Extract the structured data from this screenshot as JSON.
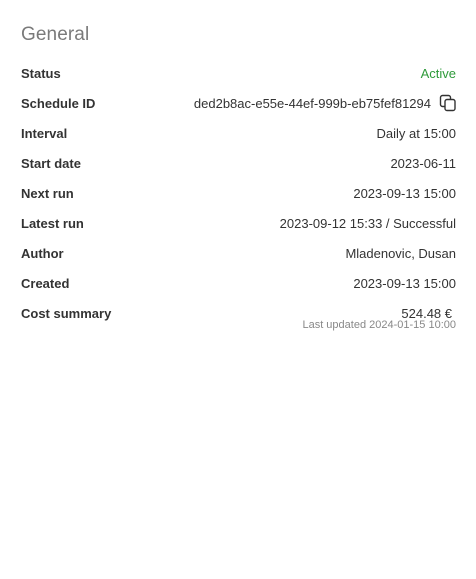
{
  "section": {
    "title": "General"
  },
  "rows": {
    "status": {
      "label": "Status",
      "value": "Active"
    },
    "schedule_id": {
      "label": "Schedule ID",
      "value": "ded2b8ac-e55e-44ef-999b-eb75fef81294"
    },
    "interval": {
      "label": "Interval",
      "value": "Daily at 15:00"
    },
    "start_date": {
      "label": "Start date",
      "value": "2023-06-11"
    },
    "next_run": {
      "label": "Next run",
      "value": "2023-09-13 15:00"
    },
    "latest_run": {
      "label": "Latest run",
      "value": "2023-09-12 15:33 / Successful"
    },
    "author": {
      "label": "Author",
      "value": "Mladenovic, Dusan"
    },
    "created": {
      "label": "Created",
      "value": "2023-09-13 15:00"
    },
    "cost_summary": {
      "label": "Cost summary",
      "value": "524.48 €"
    }
  },
  "last_updated": {
    "prefix": "Last updated",
    "timestamp": "2024-01-15 10:00"
  },
  "icons": {
    "copy": "copy-icon"
  },
  "colors": {
    "status_active": "#2e9a3a",
    "title": "#7a7a7a",
    "text": "#333333",
    "muted": "#888888"
  }
}
